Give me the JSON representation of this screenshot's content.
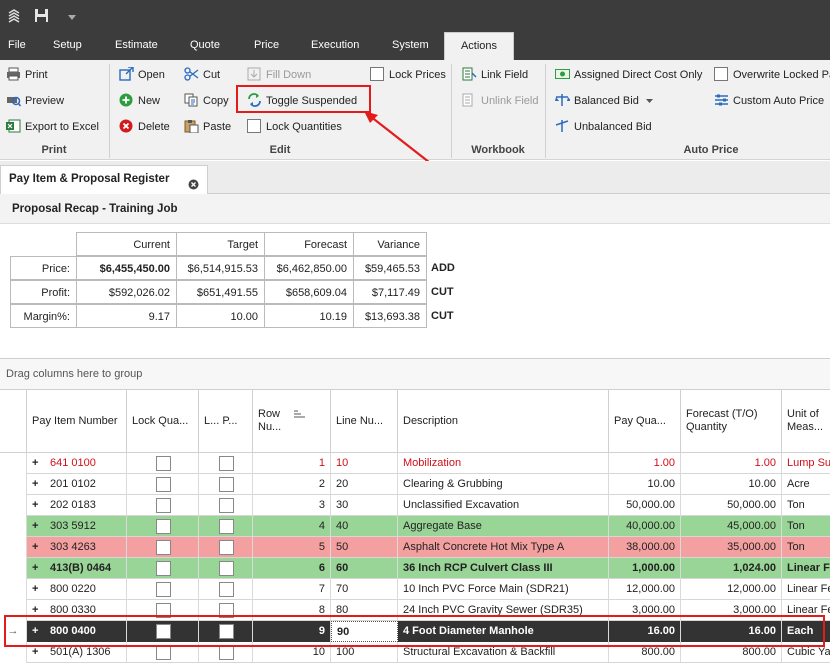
{
  "menu": {
    "file": "File",
    "setup": "Setup",
    "estimate": "Estimate",
    "quote": "Quote",
    "price": "Price",
    "execution": "Execution",
    "system": "System",
    "actions": "Actions"
  },
  "ribbon": {
    "print_group": {
      "label": "Print",
      "print": "Print",
      "preview": "Preview",
      "export": "Export to Excel"
    },
    "edit_group": {
      "label": "Edit",
      "open": "Open",
      "new": "New",
      "delete": "Delete",
      "cut": "Cut",
      "copy": "Copy",
      "paste": "Paste",
      "fill_down": "Fill Down",
      "toggle_suspended": "Toggle Suspended",
      "lock_quantities": "Lock Quantities",
      "lock_prices": "Lock Prices"
    },
    "workbook_group": {
      "label": "Workbook",
      "link_field": "Link Field",
      "unlink_field": "Unlink Field"
    },
    "auto_price_group": {
      "label": "Auto Price",
      "assigned_direct_cost_only": "Assigned Direct Cost Only",
      "balanced_bid": "Balanced Bid",
      "unbalanced_bid": "Unbalanced Bid",
      "overwrite_locked": "Overwrite Locked Pa",
      "custom_auto_price": "Custom Auto Price"
    }
  },
  "doc_tab": {
    "title": "Pay Item & Proposal Register"
  },
  "recap": {
    "title": "Proposal Recap - Training Job",
    "headers": [
      "Current",
      "Target",
      "Forecast",
      "Variance"
    ],
    "rows": [
      {
        "label": "Price:",
        "current": "$6,455,450.00",
        "target": "$6,514,915.53",
        "forecast": "$6,462,850.00",
        "variance": "$59,465.53",
        "flag": "ADD"
      },
      {
        "label": "Profit:",
        "current": "$592,026.02",
        "target": "$651,491.55",
        "forecast": "$658,609.04",
        "variance": "$7,117.49",
        "flag": "CUT"
      },
      {
        "label": "Margin%:",
        "current": "9.17",
        "target": "10.00",
        "forecast": "10.19",
        "variance": "$13,693.38",
        "flag": "CUT"
      }
    ]
  },
  "grid": {
    "drag_hint": "Drag columns here to group",
    "headers": {
      "pay_item": "Pay Item Number",
      "lock_qty": "Lock Qua...",
      "lock_price": "L... P...",
      "row_num": "Row Nu...",
      "line_num": "Line Nu...",
      "description": "Description",
      "pay_qty": "Pay Qua...",
      "forecast_qty": "Forecast (T/O) Quantity",
      "unit": "Unit of Meas..."
    },
    "rows": [
      {
        "pay_item": "641 0100",
        "row": "1",
        "line": "10",
        "desc": "Mobilization",
        "pay_qty": "1.00",
        "fc_qty": "1.00",
        "unit": "Lump Sum",
        "style": "red"
      },
      {
        "pay_item": "201 0102",
        "row": "2",
        "line": "20",
        "desc": "Clearing & Grubbing",
        "pay_qty": "10.00",
        "fc_qty": "10.00",
        "unit": "Acre",
        "style": "normal"
      },
      {
        "pay_item": "202 0183",
        "row": "3",
        "line": "30",
        "desc": "Unclassified Excavation",
        "pay_qty": "50,000.00",
        "fc_qty": "50,000.00",
        "unit": "Ton",
        "style": "normal"
      },
      {
        "pay_item": "303 5912",
        "row": "4",
        "line": "40",
        "desc": "Aggregate Base",
        "pay_qty": "40,000.00",
        "fc_qty": "45,000.00",
        "unit": "Ton",
        "style": "green"
      },
      {
        "pay_item": "303 4263",
        "row": "5",
        "line": "50",
        "desc": "Asphalt Concrete Hot Mix Type A",
        "pay_qty": "38,000.00",
        "fc_qty": "35,000.00",
        "unit": "Ton",
        "style": "pink"
      },
      {
        "pay_item": "413(B) 0464",
        "row": "6",
        "line": "60",
        "desc": "36 Inch RCP Culvert Class III",
        "pay_qty": "1,000.00",
        "fc_qty": "1,024.00",
        "unit": "Linear Fe",
        "style": "greenbold"
      },
      {
        "pay_item": "800 0220",
        "row": "7",
        "line": "70",
        "desc": "10 Inch PVC Force Main (SDR21)",
        "pay_qty": "12,000.00",
        "fc_qty": "12,000.00",
        "unit": "Linear Fe",
        "style": "normal"
      },
      {
        "pay_item": "800 0330",
        "row": "8",
        "line": "80",
        "desc": "24 Inch PVC Gravity Sewer (SDR35)",
        "pay_qty": "3,000.00",
        "fc_qty": "3,000.00",
        "unit": "Linear Fe",
        "style": "normal"
      },
      {
        "pay_item": "800 0400",
        "row": "9",
        "line": "90",
        "desc": "4 Foot Diameter Manhole",
        "pay_qty": "16.00",
        "fc_qty": "16.00",
        "unit": "Each",
        "style": "selected"
      },
      {
        "pay_item": "501(A) 1306",
        "row": "10",
        "line": "100",
        "desc": "Structural Excavation & Backfill",
        "pay_qty": "800.00",
        "fc_qty": "800.00",
        "unit": "Cubic Yar",
        "style": "normal"
      }
    ]
  },
  "colors": {
    "red_text": "#d0101a",
    "green_row": "#9ad598",
    "pink_row": "#f4a0a0",
    "selected_row": "#333333",
    "highlight": "#e41b1b"
  }
}
